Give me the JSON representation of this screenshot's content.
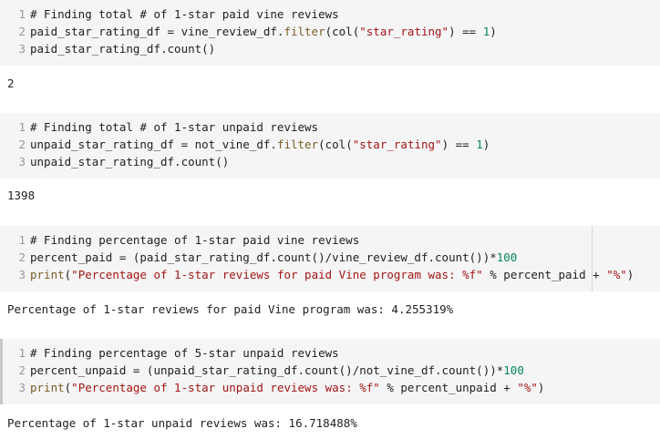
{
  "cells": [
    {
      "lines": [
        {
          "n": "1",
          "parts": [
            {
              "t": "# Finding total # of 1-star paid vine reviews",
              "c": "comment"
            }
          ]
        },
        {
          "n": "2",
          "parts": [
            {
              "t": "paid_star_rating_df = vine_review_df.",
              "c": "plain"
            },
            {
              "t": "filter",
              "c": "fn"
            },
            {
              "t": "(col(",
              "c": "plain"
            },
            {
              "t": "\"star_rating\"",
              "c": "str"
            },
            {
              "t": ") == ",
              "c": "plain"
            },
            {
              "t": "1",
              "c": "num"
            },
            {
              "t": ")",
              "c": "plain"
            }
          ]
        },
        {
          "n": "3",
          "parts": [
            {
              "t": "paid_star_rating_df.count()",
              "c": "plain"
            }
          ]
        }
      ],
      "output": "2"
    },
    {
      "lines": [
        {
          "n": "1",
          "parts": [
            {
              "t": "# Finding total # of 1-star unpaid reviews",
              "c": "comment"
            }
          ]
        },
        {
          "n": "2",
          "parts": [
            {
              "t": "unpaid_star_rating_df = not_vine_df.",
              "c": "plain"
            },
            {
              "t": "filter",
              "c": "fn"
            },
            {
              "t": "(col(",
              "c": "plain"
            },
            {
              "t": "\"star_rating\"",
              "c": "str"
            },
            {
              "t": ") == ",
              "c": "plain"
            },
            {
              "t": "1",
              "c": "num"
            },
            {
              "t": ")",
              "c": "plain"
            }
          ]
        },
        {
          "n": "3",
          "parts": [
            {
              "t": "unpaid_star_rating_df.count()",
              "c": "plain"
            }
          ]
        }
      ],
      "output": "1398"
    },
    {
      "lines": [
        {
          "n": "1",
          "parts": [
            {
              "t": "# Finding percentage of 1-star paid vine reviews",
              "c": "comment"
            }
          ]
        },
        {
          "n": "2",
          "parts": [
            {
              "t": "percent_paid = (paid_star_rating_df.count()/vine_review_df.count())*",
              "c": "plain"
            },
            {
              "t": "100",
              "c": "num"
            }
          ]
        },
        {
          "n": "3",
          "parts": [
            {
              "t": "print",
              "c": "fn"
            },
            {
              "t": "(",
              "c": "plain"
            },
            {
              "t": "\"Percentage of 1-star reviews for paid Vine program was: %f\"",
              "c": "str"
            },
            {
              "t": " % percent_paid + ",
              "c": "plain"
            },
            {
              "t": "\"%\"",
              "c": "str"
            },
            {
              "t": ")",
              "c": "plain"
            }
          ]
        }
      ],
      "output": "Percentage of 1-star reviews for paid Vine program was: 4.255319%"
    },
    {
      "lines": [
        {
          "n": "1",
          "parts": [
            {
              "t": "# Finding percentage of 5-star unpaid reviews",
              "c": "comment"
            }
          ]
        },
        {
          "n": "2",
          "parts": [
            {
              "t": "percent_unpaid = (unpaid_star_rating_df.count()/not_vine_df.count())*",
              "c": "plain"
            },
            {
              "t": "100",
              "c": "num"
            }
          ]
        },
        {
          "n": "3",
          "parts": [
            {
              "t": "print",
              "c": "fn"
            },
            {
              "t": "(",
              "c": "plain"
            },
            {
              "t": "\"Percentage of 1-star unpaid reviews was: %f\"",
              "c": "str"
            },
            {
              "t": " % percent_unpaid + ",
              "c": "plain"
            },
            {
              "t": "\"%\"",
              "c": "str"
            },
            {
              "t": ")",
              "c": "plain"
            }
          ]
        }
      ],
      "output": "Percentage of 1-star unpaid reviews was: 16.718488%"
    }
  ]
}
